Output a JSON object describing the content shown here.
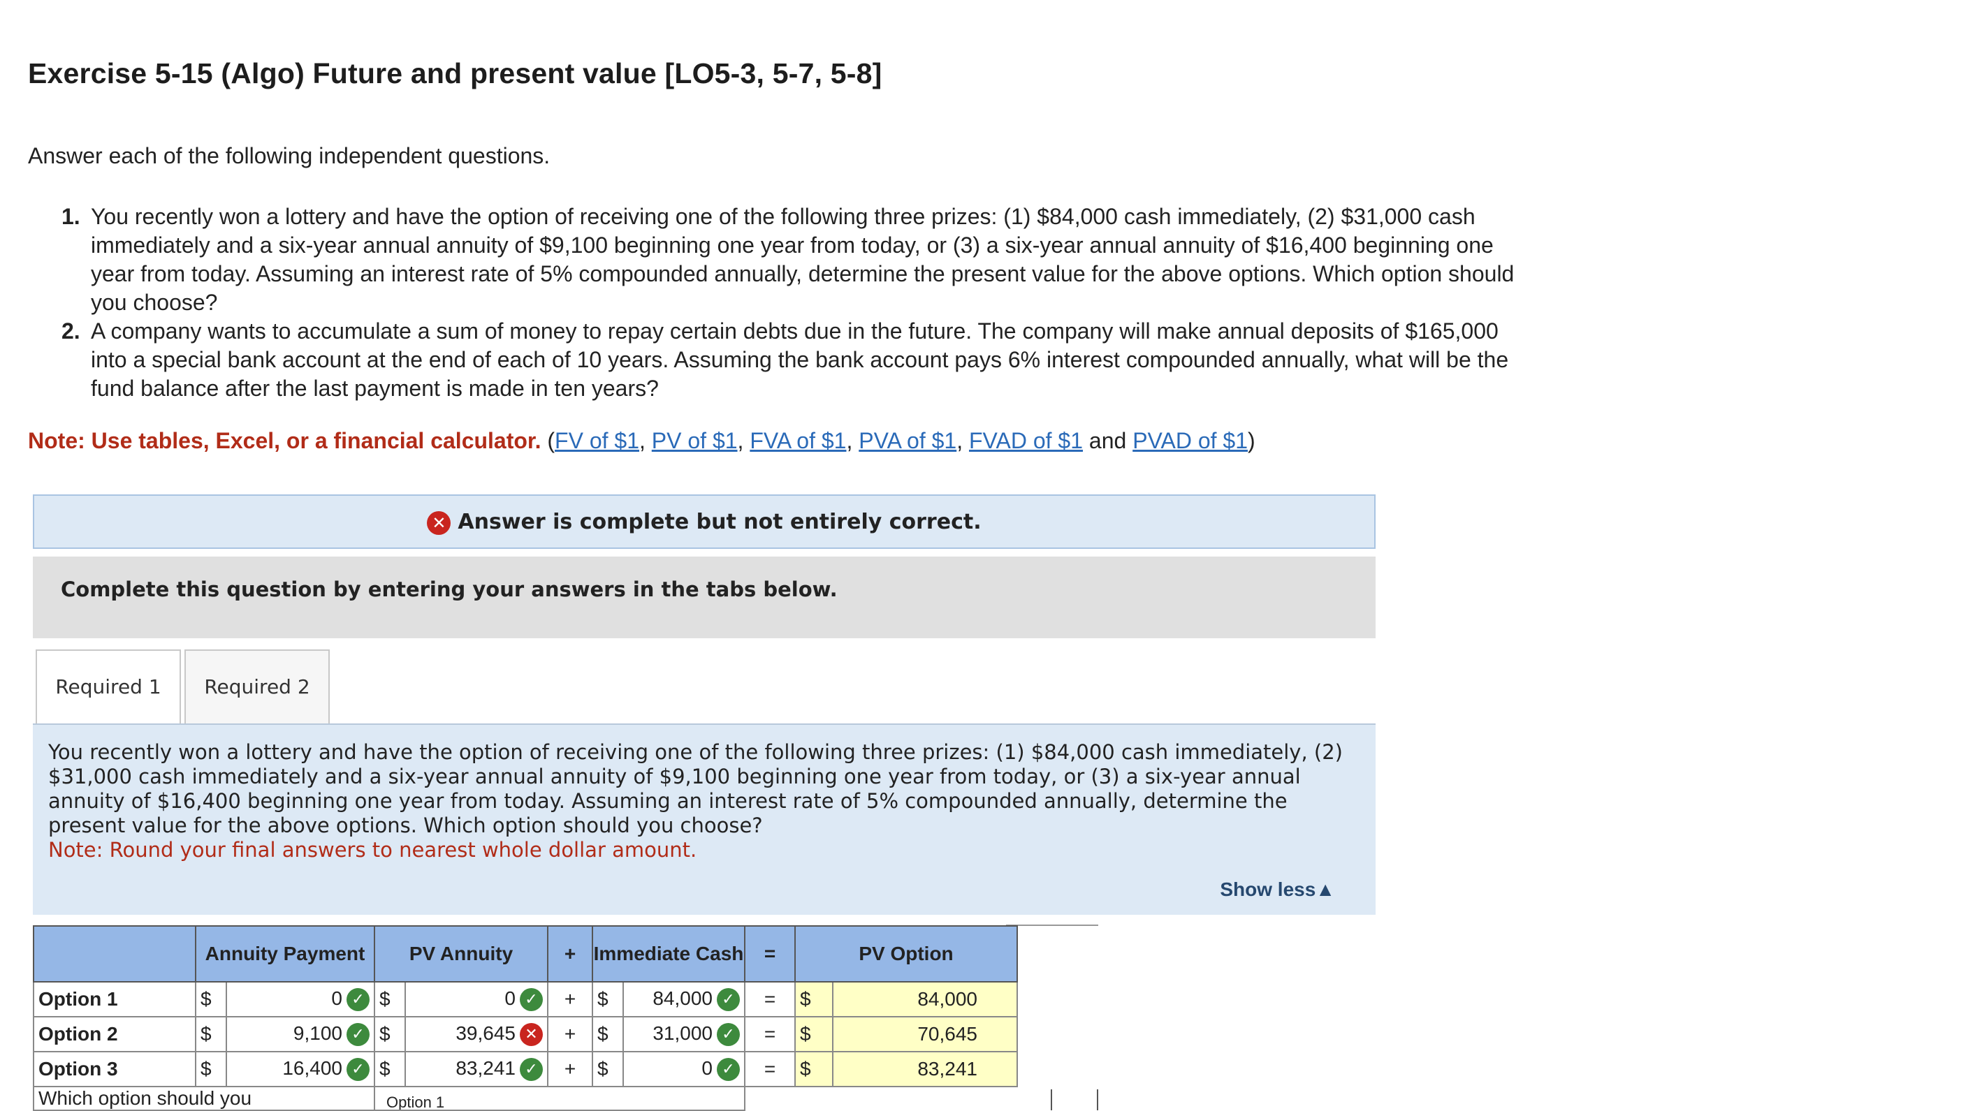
{
  "title": "Exercise 5-15 (Algo) Future and present value [LO5-3, 5-7, 5-8]",
  "intro": "Answer each of the following independent questions.",
  "questions": [
    {
      "num": "1.",
      "text": "You recently won a lottery and have the option of receiving one of the following three prizes: (1) $84,000 cash immediately, (2) $31,000 cash immediately and a six-year annual annuity of $9,100 beginning one year from today, or (3) a six-year annual annuity of $16,400 beginning one year from today. Assuming an interest rate of 5% compounded annually, determine the present value for the above options. Which option should you choose?"
    },
    {
      "num": "2.",
      "text": "A company wants to accumulate a sum of money to repay certain debts due in the future. The company will make annual deposits of $165,000 into a special bank account at the end of each of 10 years. Assuming the bank account pays 6% interest compounded annually, what will be the fund balance after the last payment is made in ten years?"
    }
  ],
  "note": {
    "label": "Note: Use tables, Excel, or a financial calculator.",
    "open": " (",
    "links": [
      "FV of $1",
      "PV of $1",
      "FVA of $1",
      "PVA of $1",
      "FVAD of $1",
      "PVAD of $1"
    ],
    "sep": ", ",
    "and": " and ",
    "close": ")"
  },
  "feedback": {
    "icon": "x-circle-icon",
    "text": "Answer is complete but not entirely correct."
  },
  "instruction": "Complete this question by entering your answers in the tabs below.",
  "tabs": [
    {
      "label": "Required 1",
      "active": true
    },
    {
      "label": "Required 2",
      "active": false
    }
  ],
  "question_panel": {
    "text": "You recently won a lottery and have the option of receiving one of the following three prizes: (1) $84,000 cash immediately, (2) $31,000 cash immediately and a six-year annual annuity of $9,100 beginning one year from today, or (3) a six-year annual annuity of $16,400 beginning one year from today. Assuming an interest rate of 5% compounded annually, determine the present value for the above options. Which option should you choose?",
    "note": "Note: Round your final answers to nearest whole dollar amount.",
    "show_less": "Show less",
    "show_less_icon": "triangle-up-icon"
  },
  "table": {
    "headers": {
      "annuity_payment": "Annuity Payment",
      "pv_annuity": "PV Annuity",
      "plus": "+",
      "immediate_cash": "Immediate Cash",
      "equals": "=",
      "pv_option": "PV Option"
    },
    "rows": [
      {
        "label": "Option 1",
        "cur1": "$",
        "annuity": "0",
        "annuity_status": "correct",
        "cur2": "$",
        "pv_annuity": "0",
        "pv_status": "correct",
        "plus": "+",
        "cur3": "$",
        "cash": "84,000",
        "cash_status": "correct",
        "eq": "=",
        "cur4": "$",
        "pv_option": "84,000"
      },
      {
        "label": "Option 2",
        "cur1": "$",
        "annuity": "9,100",
        "annuity_status": "correct",
        "cur2": "$",
        "pv_annuity": "39,645",
        "pv_status": "incorrect",
        "plus": "+",
        "cur3": "$",
        "cash": "31,000",
        "cash_status": "correct",
        "eq": "=",
        "cur4": "$",
        "pv_option": "70,645"
      },
      {
        "label": "Option 3",
        "cur1": "$",
        "annuity": "16,400",
        "annuity_status": "correct",
        "cur2": "$",
        "pv_annuity": "83,241",
        "pv_status": "correct",
        "plus": "+",
        "cur3": "$",
        "cash": "0",
        "cash_status": "correct",
        "eq": "=",
        "cur4": "$",
        "pv_option": "83,241"
      }
    ],
    "which_label": "Which option should you",
    "which_value": "Option 1",
    "which_status": "correct"
  }
}
